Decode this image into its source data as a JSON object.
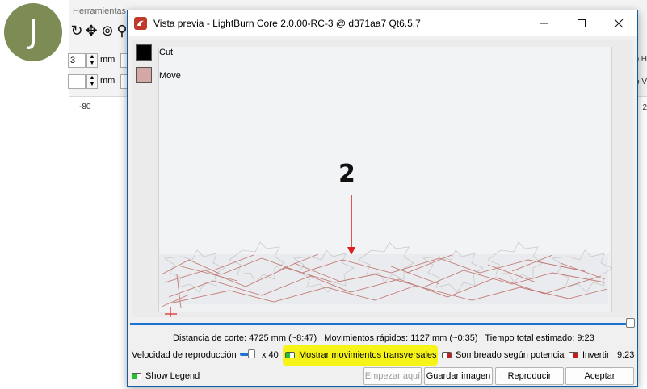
{
  "avatar": {
    "letter": "J",
    "color": "#7d8c55"
  },
  "background_app": {
    "menu_text": "Herramientas",
    "spin1_value": "3",
    "spin2_value": "",
    "unit": "mm",
    "ruler_tick": "-80",
    "right_text_1": "o H",
    "right_text_2": "o V",
    "right_text_3": "2",
    "toolbar_icons": [
      "rotate-icon",
      "move-icon",
      "zoom-fit-icon",
      "zoom-icon"
    ]
  },
  "dialog": {
    "title": "Vista previa - LightBurn Core 2.0.00-RC-3 @ d371aa7 Qt6.5.7",
    "window_buttons": [
      "minimize-icon",
      "maximize-icon",
      "close-icon"
    ],
    "legend": [
      {
        "label": "Cut",
        "color": "#000000"
      },
      {
        "label": "Move",
        "color": "#d4a9a5"
      }
    ],
    "annotation_number": "2",
    "stats": {
      "cut_distance": "Distancia de corte: 4725 mm (~8:47)",
      "rapid_moves": "Movimientos rápidos: 1127 mm (~0:35)",
      "total_time": "Tiempo total estimado: 9:23"
    },
    "playback_speed_label": "Velocidad de reproducción",
    "playback_speed_value": "x 40",
    "show_traversal_label": "Mostrar movimientos transversales",
    "show_traversal_on": true,
    "power_shading_label": "Sombreado según potencia",
    "power_shading_on": false,
    "invert_label": "Invertir",
    "invert_on": false,
    "time_readout": "9:23",
    "show_legend_label": "Show Legend",
    "show_legend_on": true,
    "playback_progress": 1.0,
    "playback_speed_level": 0.6,
    "buttons": {
      "start_here": "Empezar aquí",
      "save_image": "Guardar imagen",
      "play": "Reproducir",
      "accept": "Aceptar"
    },
    "colors": {
      "accent": "#1e73d2",
      "toggle_on": "#23c12d",
      "toggle_off": "#c41f1f",
      "highlight": "#f5f318",
      "annotation_arrow": "#e02020"
    }
  }
}
